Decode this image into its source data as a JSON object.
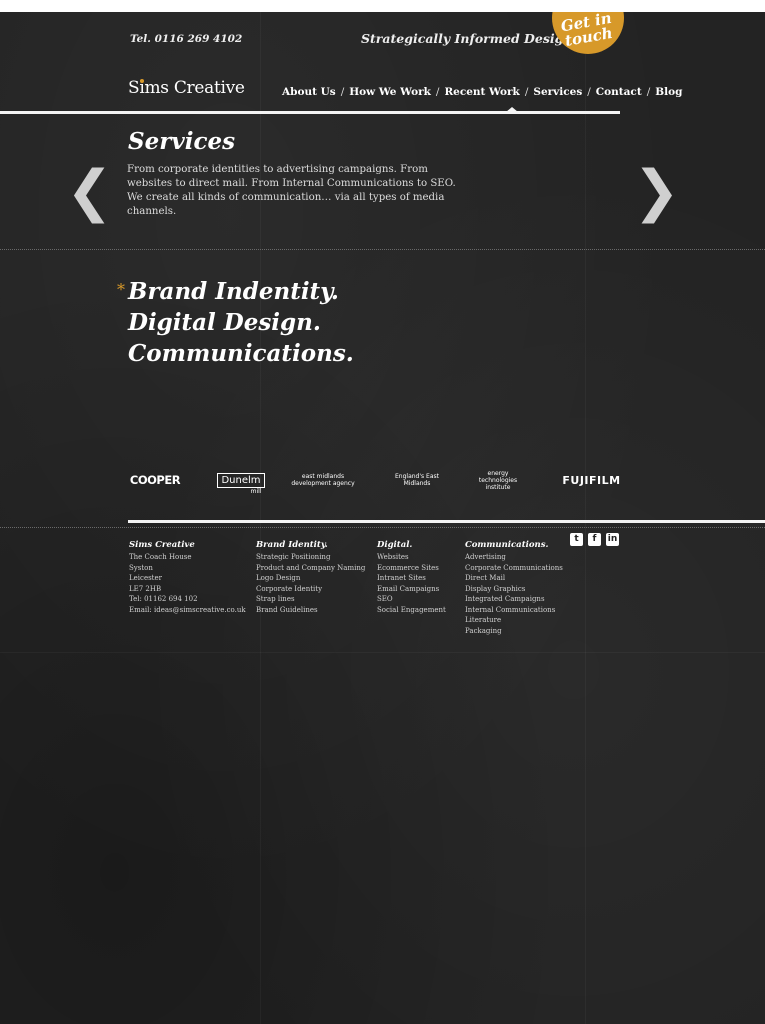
{
  "header": {
    "phone": "Tel. 0116 269 4102",
    "tagline": "Strategically Informed Design",
    "cta": "Get in\ntouch",
    "logo": "Sims Creative"
  },
  "nav": {
    "items": [
      {
        "label": "About Us"
      },
      {
        "label": "How We Work"
      },
      {
        "label": "Recent Work"
      },
      {
        "label": "Services"
      },
      {
        "label": "Contact"
      },
      {
        "label": "Blog"
      }
    ],
    "separator": "/"
  },
  "services": {
    "title": "Services",
    "intro": "From corporate identities to advertising campaigns. From websites to direct mail. From Internal Communications to SEO. We create all kinds of communication… via all types of media channels.",
    "prev_arrow": "❮",
    "next_arrow": "❯"
  },
  "headline": {
    "asterisk": "*",
    "lines": [
      "Brand Indentity.",
      "Digital Design.",
      "Communications."
    ]
  },
  "clients": [
    {
      "name": "COOPER"
    },
    {
      "name": "Dunelm",
      "sub": "mill"
    },
    {
      "name": "east midlands development agency"
    },
    {
      "name": "England's East Midlands"
    },
    {
      "name": "energy technologies institute"
    },
    {
      "name": "FUJIFILM"
    }
  ],
  "footer": {
    "contact": {
      "title": "Sims Creative",
      "lines": [
        "The Coach House",
        "Syston",
        "Leicester",
        "LE7 2HB",
        "Tel: 01162 694 102",
        "Email: ideas@simscreative.co.uk"
      ]
    },
    "brand_identity": {
      "title": "Brand Identity.",
      "links": [
        "Strategic Positioning",
        "Product and Company Naming",
        "Logo Design",
        "Corporate Identity",
        "Strap lines",
        "Brand Guidelines"
      ]
    },
    "digital": {
      "title": "Digital.",
      "links": [
        "Websites",
        "Ecommerce Sites",
        "Intranet Sites",
        "Email Campaigns",
        "SEO",
        "Social Engagement"
      ]
    },
    "communications": {
      "title": "Communications.",
      "links": [
        "Advertising",
        "Corporate Communications",
        "Direct Mail",
        "Display Graphics",
        "Integrated Campaigns",
        "Internal Communications",
        "Literature",
        "Packaging"
      ]
    },
    "social": [
      {
        "icon": "twitter-icon",
        "glyph": "t"
      },
      {
        "icon": "facebook-icon",
        "glyph": "f"
      },
      {
        "icon": "linkedin-icon",
        "glyph": "in"
      }
    ]
  },
  "colors": {
    "background": "#232323",
    "accent": "#d7992a",
    "text": "#ffffff"
  }
}
